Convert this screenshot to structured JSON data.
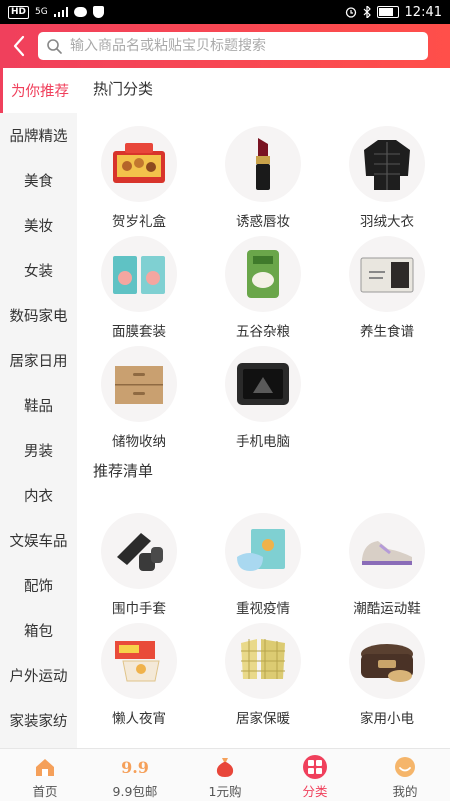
{
  "status_bar": {
    "left_badges": [
      "HD",
      "5G"
    ],
    "time": "12:41"
  },
  "header": {
    "search_placeholder": "输入商品名或粘贴宝贝标题搜索"
  },
  "sidebar": {
    "items": [
      {
        "label": "为你推荐",
        "active": true
      },
      {
        "label": "品牌精选"
      },
      {
        "label": "美食"
      },
      {
        "label": "美妆"
      },
      {
        "label": "女装"
      },
      {
        "label": "数码家电"
      },
      {
        "label": "居家日用"
      },
      {
        "label": "鞋品"
      },
      {
        "label": "男装"
      },
      {
        "label": "内衣"
      },
      {
        "label": "文娱车品"
      },
      {
        "label": "配饰"
      },
      {
        "label": "箱包"
      },
      {
        "label": "户外运动"
      },
      {
        "label": "家装家纺"
      }
    ]
  },
  "sections": [
    {
      "title": "热门分类",
      "items": [
        {
          "label": "贺岁礼盒",
          "icon": "gift-box-icon"
        },
        {
          "label": "诱惑唇妆",
          "icon": "lipstick-icon"
        },
        {
          "label": "羽绒大衣",
          "icon": "down-jacket-icon"
        },
        {
          "label": "面膜套装",
          "icon": "face-mask-icon"
        },
        {
          "label": "五谷杂粮",
          "icon": "rice-bag-icon"
        },
        {
          "label": "养生食谱",
          "icon": "tea-box-icon"
        },
        {
          "label": "储物收纳",
          "icon": "storage-drawer-icon"
        },
        {
          "label": "手机电脑",
          "icon": "rugged-phone-icon"
        }
      ]
    },
    {
      "title": "推荐清单",
      "items": [
        {
          "label": "围巾手套",
          "icon": "scarf-gloves-icon"
        },
        {
          "label": "重视疫情",
          "icon": "medical-mask-icon"
        },
        {
          "label": "潮酷运动鞋",
          "icon": "sneaker-icon"
        },
        {
          "label": "懒人夜宵",
          "icon": "instant-noodles-icon"
        },
        {
          "label": "居家保暖",
          "icon": "pajamas-icon"
        },
        {
          "label": "家用小电",
          "icon": "rice-cooker-icon"
        }
      ]
    }
  ],
  "tabbar": {
    "items": [
      {
        "label": "首页",
        "icon": "home-icon"
      },
      {
        "label": "9.9包邮",
        "icon_text": "9.9"
      },
      {
        "label": "1元购",
        "icon": "money-bag-icon"
      },
      {
        "label": "分类",
        "icon": "category-icon",
        "active": true
      },
      {
        "label": "我的",
        "icon": "smiley-icon"
      }
    ]
  },
  "colors": {
    "accent": "#f0405c",
    "header_gradient_end": "#ff4f4a",
    "sidebar_bg": "#f5f5f5"
  }
}
